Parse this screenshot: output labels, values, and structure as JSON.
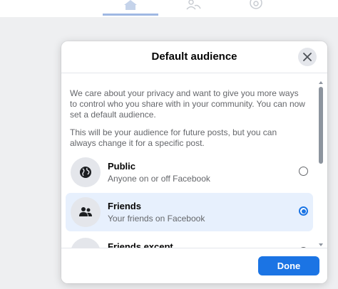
{
  "dialog": {
    "title": "Default audience",
    "description_1": "We care about your privacy and want to give you more ways to control who you share with in your community. You can now set a default audience.",
    "description_2": "This will be your audience for future posts, but you can always change it for a specific post.",
    "options": [
      {
        "title": "Public",
        "subtitle": "Anyone on or off Facebook",
        "icon": "globe-icon",
        "selected": false
      },
      {
        "title": "Friends",
        "subtitle": "Your friends on Facebook",
        "icon": "friends-icon",
        "selected": true
      },
      {
        "title": "Friends except...",
        "subtitle": "",
        "icon": "friends-except-icon",
        "selected": false
      }
    ],
    "done_label": "Done"
  },
  "colors": {
    "accent": "#1b74e4",
    "selected_bg": "#e7f0fd",
    "icon_bg": "#e4e6eb",
    "backdrop": "#eeeff1"
  }
}
